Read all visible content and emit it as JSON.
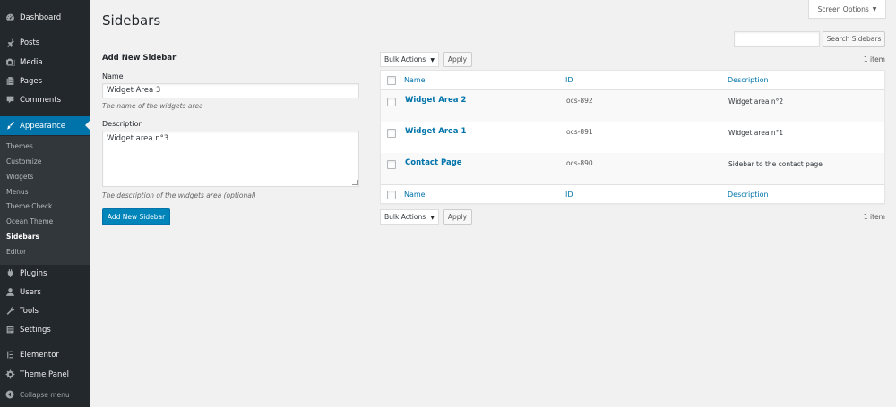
{
  "sidebar": {
    "menu": [
      {
        "id": "dashboard",
        "label": "Dashboard",
        "icon": "dashboard-icon"
      },
      {
        "id": "posts",
        "label": "Posts",
        "icon": "pushpin-icon"
      },
      {
        "id": "media",
        "label": "Media",
        "icon": "media-icon"
      },
      {
        "id": "pages",
        "label": "Pages",
        "icon": "pages-icon"
      },
      {
        "id": "comments",
        "label": "Comments",
        "icon": "comment-icon"
      },
      {
        "id": "appearance",
        "label": "Appearance",
        "icon": "paintbrush-icon"
      },
      {
        "id": "plugins",
        "label": "Plugins",
        "icon": "plugin-icon"
      },
      {
        "id": "users",
        "label": "Users",
        "icon": "user-icon"
      },
      {
        "id": "tools",
        "label": "Tools",
        "icon": "wrench-icon"
      },
      {
        "id": "settings",
        "label": "Settings",
        "icon": "settings-icon"
      },
      {
        "id": "elementor",
        "label": "Elementor",
        "icon": "elementor-icon"
      },
      {
        "id": "theme-panel",
        "label": "Theme Panel",
        "icon": "gear-icon"
      }
    ],
    "current": "Appearance",
    "submenu": [
      "Themes",
      "Customize",
      "Widgets",
      "Menus",
      "Theme Check",
      "Ocean Theme",
      "Sidebars",
      "Editor"
    ],
    "submenu_current": "Sidebars",
    "collapse_label": "Collapse menu",
    "accent": "#0073aa"
  },
  "header": {
    "title": "Sidebars",
    "screen_options": "Screen Options",
    "search_button": "Search Sidebars",
    "search_value": ""
  },
  "form": {
    "heading": "Add New Sidebar",
    "name_label": "Name",
    "name_value": "Widget Area 3",
    "name_hint": "The name of the widgets area",
    "desc_label": "Description",
    "desc_value": "Widget area n°3",
    "desc_hint": "The description of the widgets area (optional)",
    "submit_label": "Add New Sidebar"
  },
  "table": {
    "bulk_actions": "Bulk Actions",
    "apply": "Apply",
    "count": "1 item",
    "columns": {
      "name": "Name",
      "id": "ID",
      "description": "Description"
    },
    "rows": [
      {
        "name": "Widget Area 2",
        "id": "ocs-892",
        "description": "Widget area n°2"
      },
      {
        "name": "Widget Area 1",
        "id": "ocs-891",
        "description": "Widget area n°1"
      },
      {
        "name": "Contact Page",
        "id": "ocs-890",
        "description": "Sidebar to the contact page"
      }
    ]
  }
}
